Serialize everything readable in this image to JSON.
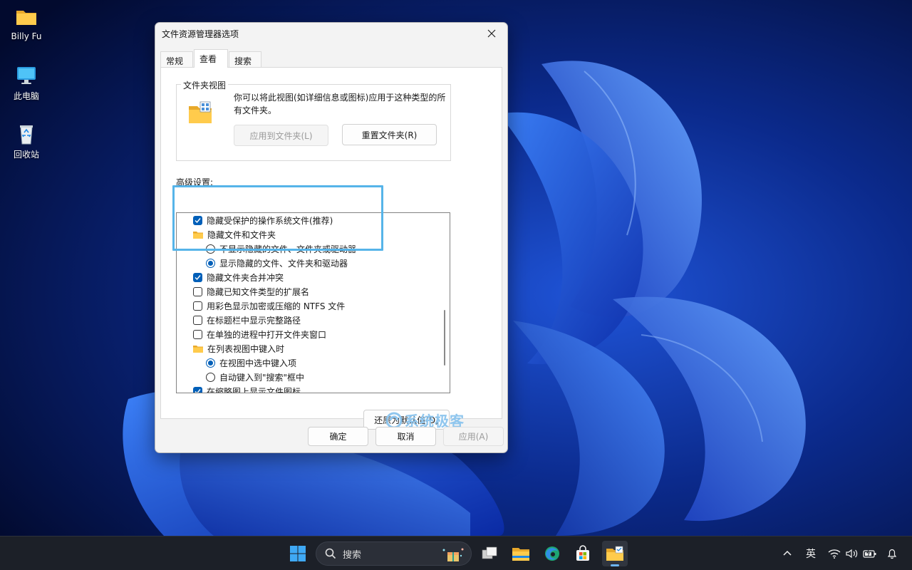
{
  "desktop": {
    "icons": [
      {
        "label": "Billy Fu",
        "icon": "folder-icon"
      },
      {
        "label": "此电脑",
        "icon": "computer-icon"
      },
      {
        "label": "回收站",
        "icon": "recycle-bin-icon"
      }
    ]
  },
  "dialog": {
    "title": "文件资源管理器选项",
    "tabs": [
      {
        "label": "常规",
        "active": false
      },
      {
        "label": "查看",
        "active": true
      },
      {
        "label": "搜索",
        "active": false
      }
    ],
    "folder_views": {
      "legend": "文件夹视图",
      "description": "你可以将此视图(如详细信息或图标)应用于这种类型的所有文件夹。",
      "apply_button": "应用到文件夹(L)",
      "reset_button": "重置文件夹(R)"
    },
    "advanced_label": "高级设置:",
    "settings": [
      {
        "type": "checkbox",
        "checked": true,
        "indent": 0,
        "label": "隐藏受保护的操作系统文件(推荐)"
      },
      {
        "type": "folder",
        "checked": false,
        "indent": 0,
        "label": "隐藏文件和文件夹"
      },
      {
        "type": "radio",
        "checked": false,
        "indent": 1,
        "label": "不显示隐藏的文件、文件夹或驱动器"
      },
      {
        "type": "radio",
        "checked": true,
        "indent": 1,
        "label": "显示隐藏的文件、文件夹和驱动器"
      },
      {
        "type": "checkbox",
        "checked": true,
        "indent": 0,
        "label": "隐藏文件夹合并冲突"
      },
      {
        "type": "checkbox",
        "checked": false,
        "indent": 0,
        "label": "隐藏已知文件类型的扩展名"
      },
      {
        "type": "checkbox",
        "checked": false,
        "indent": 0,
        "label": "用彩色显示加密或压缩的 NTFS 文件"
      },
      {
        "type": "checkbox",
        "checked": false,
        "indent": 0,
        "label": "在标题栏中显示完整路径"
      },
      {
        "type": "checkbox",
        "checked": false,
        "indent": 0,
        "label": "在单独的进程中打开文件夹窗口"
      },
      {
        "type": "folder",
        "checked": false,
        "indent": 0,
        "label": "在列表视图中键入时"
      },
      {
        "type": "radio",
        "checked": true,
        "indent": 1,
        "label": "在视图中选中键入项"
      },
      {
        "type": "radio",
        "checked": false,
        "indent": 1,
        "label": "自动键入到\"搜索\"框中"
      },
      {
        "type": "checkbox",
        "checked": true,
        "indent": 0,
        "label": "在缩略图上显示文件图标"
      }
    ],
    "restore_defaults_button": "还原为默认值(D)",
    "ok_button": "确定",
    "cancel_button": "取消",
    "apply_button": "应用(A)"
  },
  "watermark": {
    "text": "系统极客"
  },
  "taskbar": {
    "search_placeholder": "搜索",
    "tray": {
      "ime": "英"
    }
  },
  "colors": {
    "accent": "#005fb8",
    "highlight_border": "#56b4e9",
    "taskbar": "#1c2028"
  }
}
